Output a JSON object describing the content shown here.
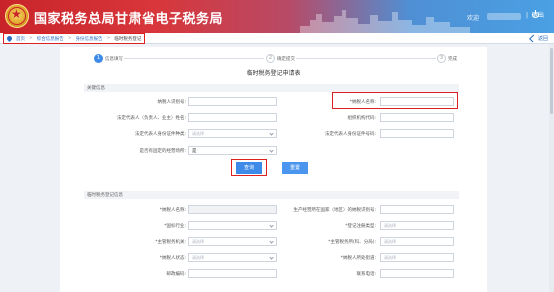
{
  "header": {
    "title": "国家税务总局甘肃省电子税务局",
    "welcome": "欢迎",
    "separator": "|",
    "logout": "退出"
  },
  "breadcrumb": {
    "items": [
      "首页",
      "综合信息报告",
      "身份信息报告",
      "临时税务登记"
    ],
    "separators": [
      ">",
      ">",
      ">"
    ],
    "back": "返回"
  },
  "steps": [
    {
      "number": "1",
      "label": "信息填写"
    },
    {
      "number": "2",
      "label": "确定提交"
    },
    {
      "number": "3",
      "label": "完成"
    }
  ],
  "form_title": "临时税务登记申请表",
  "query_section": {
    "title": "关键信息",
    "fields": {
      "taxpayer_id": {
        "label": "纳税人识别号:"
      },
      "taxpayer_name": {
        "label": "*纳税人名称:"
      },
      "legal_rep_name": {
        "label": "法定代表人（负责人、业主）姓名:"
      },
      "org_code": {
        "label": "组织机构代码:"
      },
      "legal_id_type": {
        "label": "法定代表人身份证件种类:",
        "placeholder": "请选择"
      },
      "legal_id_number": {
        "label": "法定代表人身份证件号码:"
      },
      "has_fixed_place": {
        "label": "是否有固定的经营场所:",
        "value": "是"
      }
    },
    "buttons": {
      "query": "查询",
      "reset": "重置"
    }
  },
  "registration_section": {
    "title": "临时税务登记信息",
    "fields": {
      "taxpayer_name": {
        "label": "*纳税人名称:"
      },
      "country_region": {
        "label": "生产经营所在国家（地区）的纳税识别号:"
      },
      "industry": {
        "label": "*国标行业:",
        "placeholder": "请选择"
      },
      "registration_type": {
        "label": "*登记注册类型:",
        "placeholder": "请选择"
      },
      "tax_authority": {
        "label": "*主管税务机关:",
        "placeholder": "请选择"
      },
      "tax_office_district": {
        "label": "*主管税务所(科、分局):",
        "placeholder": "请选择"
      },
      "taxpayer_status": {
        "label": "*纳税人状态:",
        "placeholder": "请选择"
      },
      "taxpayer_category": {
        "label": "*纳税人所处街道:",
        "placeholder": "请选择"
      },
      "business_scope": {
        "label": "邮政编码:"
      },
      "contact_phone": {
        "label": "联系电话:"
      }
    }
  }
}
